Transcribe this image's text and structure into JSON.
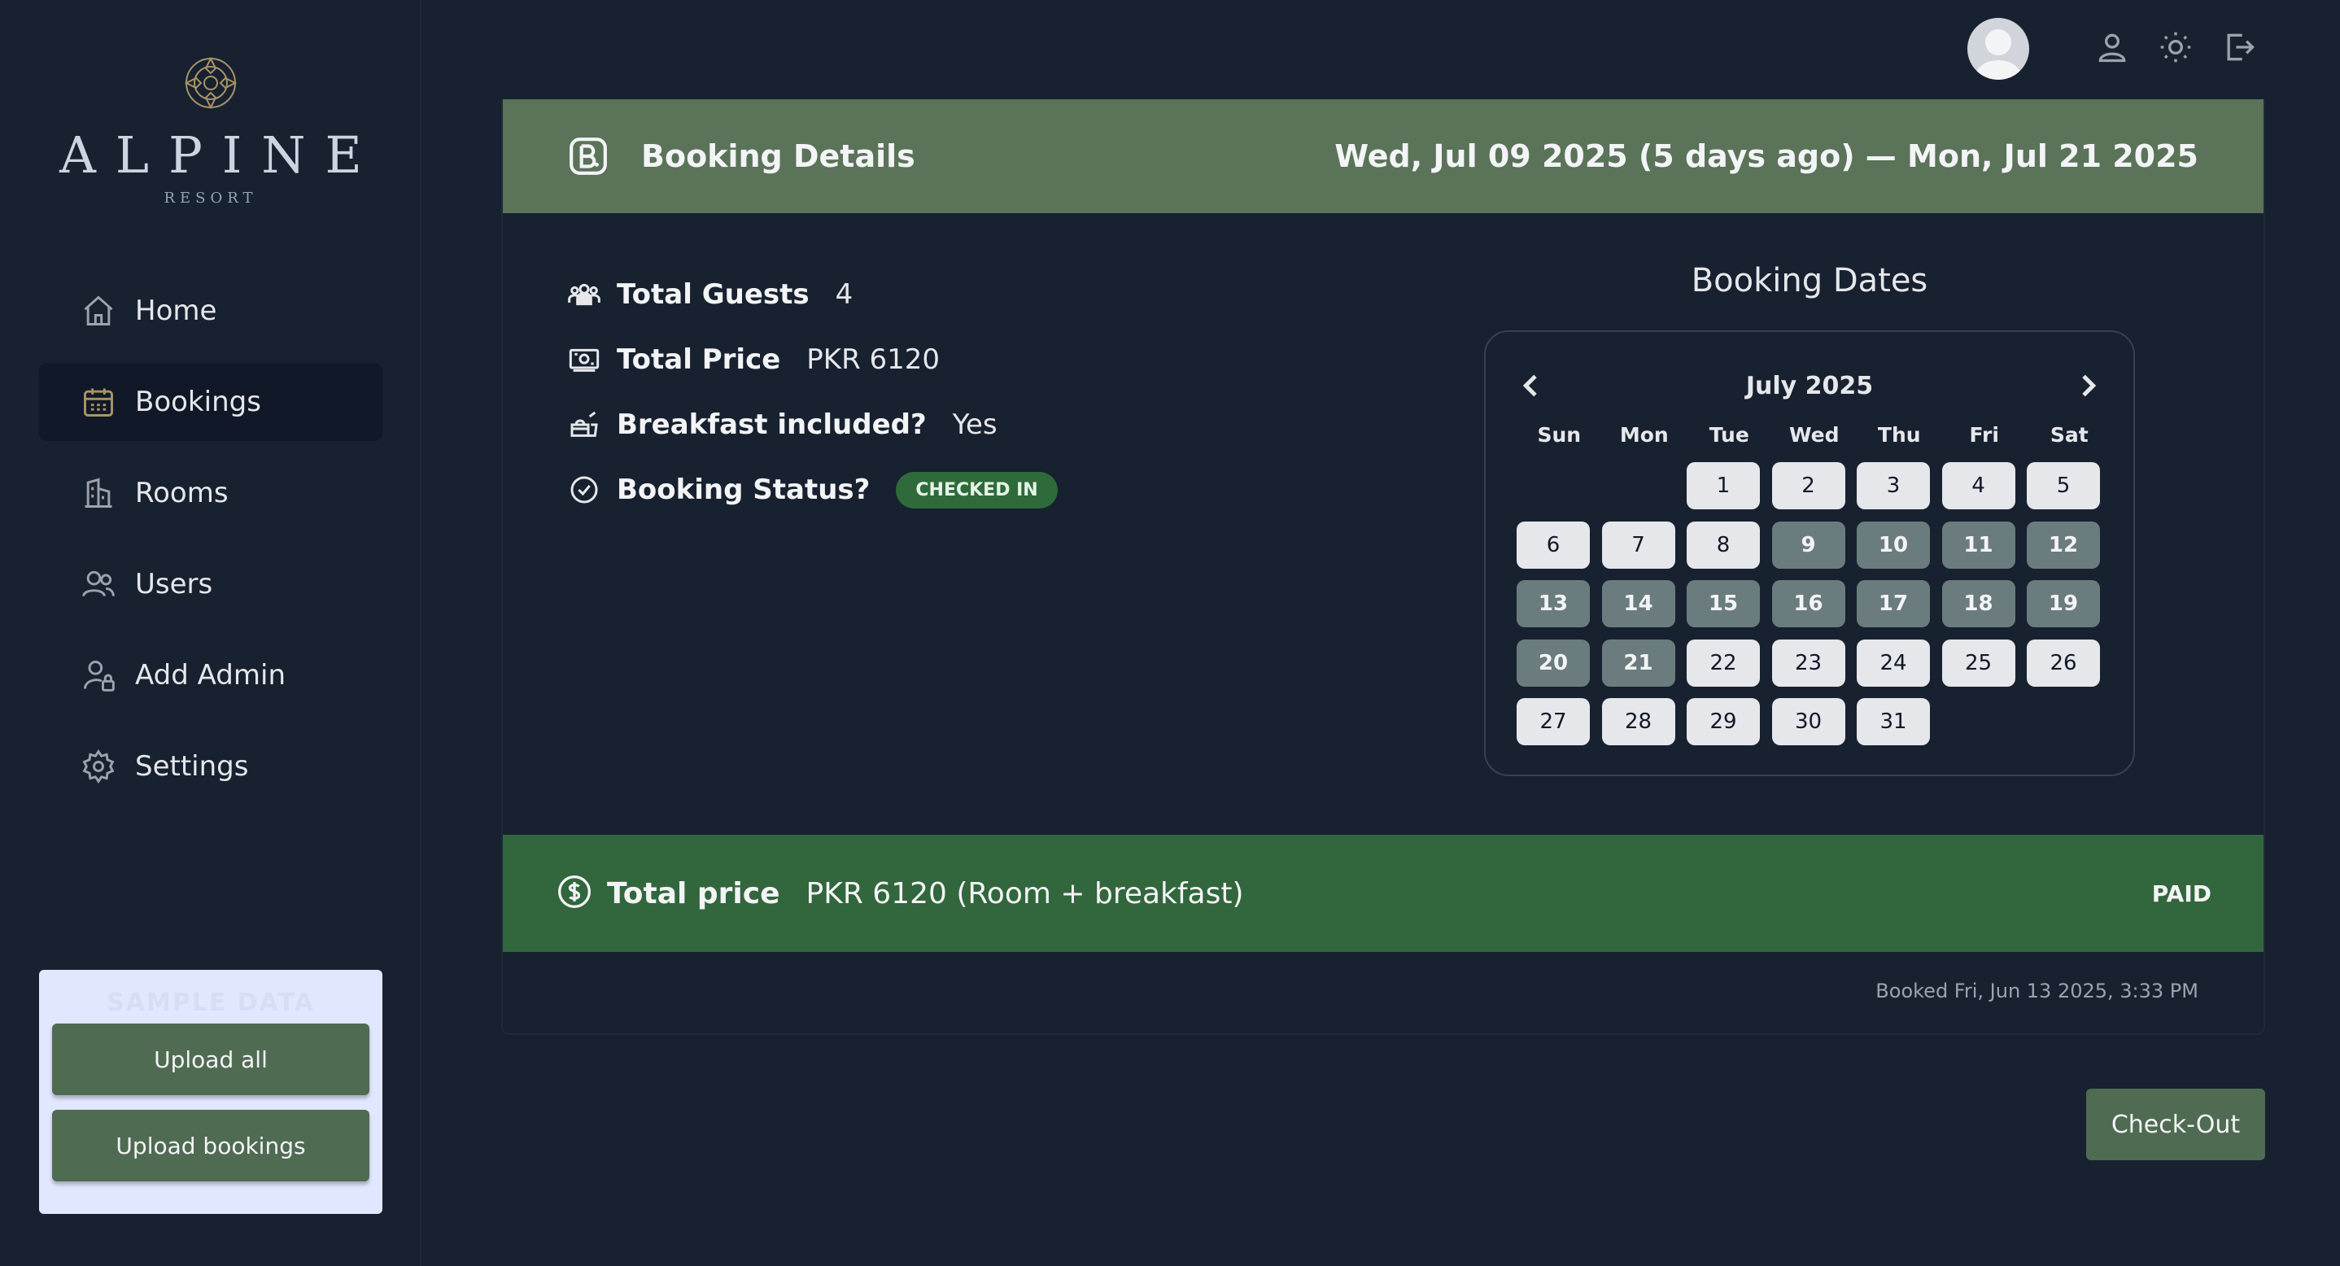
{
  "sidebar": {
    "brand": "ALPINE",
    "brand_sub": "RESORT",
    "items": [
      {
        "label": "Home",
        "icon": "home-icon"
      },
      {
        "label": "Bookings",
        "icon": "calendar-icon",
        "active": true
      },
      {
        "label": "Rooms",
        "icon": "building-icon"
      },
      {
        "label": "Users",
        "icon": "users-icon"
      },
      {
        "label": "Add Admin",
        "icon": "user-lock-icon"
      },
      {
        "label": "Settings",
        "icon": "gear-icon"
      }
    ],
    "upload": {
      "header": "SAMPLE DATA",
      "upload_all": "Upload all",
      "upload_bookings": "Upload bookings"
    }
  },
  "header": {
    "icons": [
      "avatar",
      "user-icon",
      "sun-icon",
      "logout-icon"
    ]
  },
  "booking": {
    "title": "Booking Details",
    "date_range": "Wed, Jul 09 2025 (5 days ago) — Mon, Jul 21 2025",
    "total_guests_label": "Total Guests",
    "total_guests": "4",
    "total_price_label": "Total Price",
    "total_price": "PKR 6120",
    "breakfast_label": "Breakfast included?",
    "breakfast": "Yes",
    "status_label": "Booking Status?",
    "status": "CHECKED IN",
    "calendar": {
      "title": "Booking Dates",
      "month": "July 2025",
      "weekdays": [
        "Sun",
        "Mon",
        "Tue",
        "Wed",
        "Thu",
        "Fri",
        "Sat"
      ],
      "first_weekday_index": 2,
      "days_in_month": 31,
      "selected_from": 9,
      "selected_to": 21
    },
    "total_bar": {
      "label": "Total price",
      "value": "PKR 6120 (Room + breakfast)",
      "status": "PAID"
    },
    "booked_on": "Booked Fri, Jun 13 2025, 3:33 PM"
  },
  "actions": {
    "checkout": "Check-Out"
  },
  "colors": {
    "background": "#18212f",
    "header_green": "#5a7359",
    "total_green": "#32663c",
    "button_green": "#4f6b52",
    "badge_green": "#2f6b3a",
    "selected_day": "#6b7c7e"
  }
}
